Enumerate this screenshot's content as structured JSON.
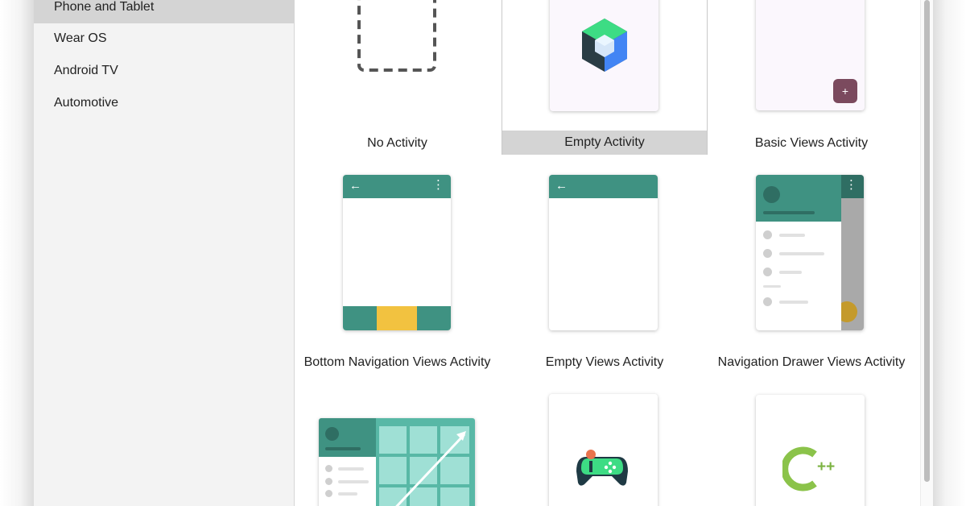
{
  "sidebar": {
    "items": [
      {
        "label": "Phone and Tablet"
      },
      {
        "label": "Wear OS"
      },
      {
        "label": "Android TV"
      },
      {
        "label": "Automotive"
      }
    ]
  },
  "templates": {
    "no_activity": "No Activity",
    "empty_activity": "Empty Activity",
    "basic_views_activity": "Basic Views Activity",
    "bottom_navigation_views_activity": "Bottom Navigation Views Activity",
    "empty_views_activity": "Empty Views Activity",
    "navigation_drawer_views_activity": "Navigation Drawer Views Activity"
  },
  "icons": {
    "back": "←",
    "more": "⋮",
    "fab_plus": "+",
    "cpp_plus": "++"
  },
  "colors": {
    "accent_teal": "#3f9282",
    "selected_bg": "#d4d4d4",
    "sidebar_bg": "#f3f3f3",
    "fab_purple": "#7b4a5e",
    "nav_yellow": "#f2c240",
    "compose_green": "#3ddc84",
    "compose_blue": "#4285f4",
    "gamepad_green": "#3ddc84",
    "cpp_green": "#8bc34a"
  }
}
